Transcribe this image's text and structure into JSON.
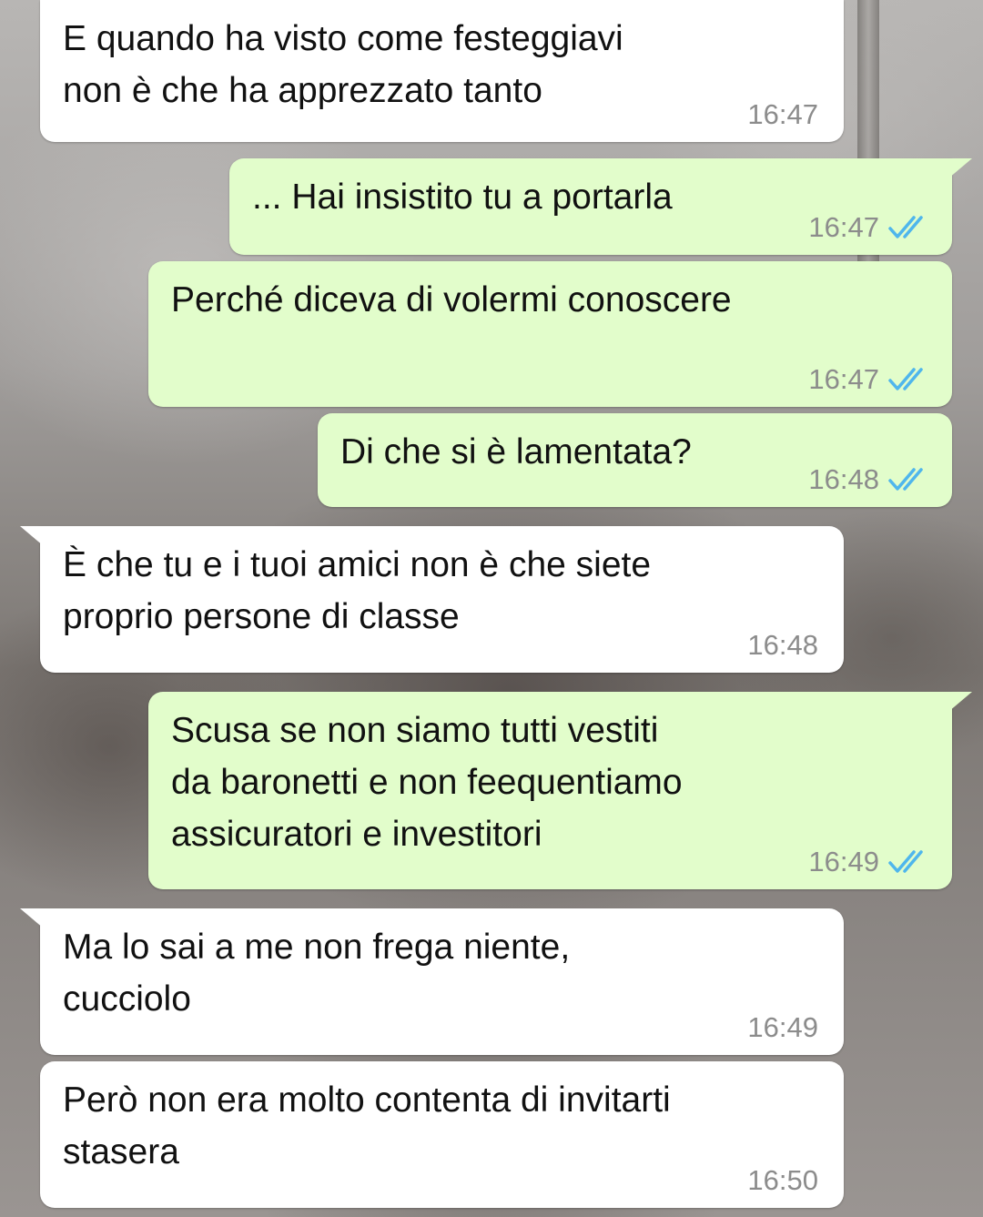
{
  "conversation": {
    "messages": [
      {
        "direction": "incoming",
        "text": "E quando ha visto come festeggiavi\nnon è che ha apprezzato tanto",
        "time": "16:47"
      },
      {
        "direction": "outgoing",
        "text": "... Hai insistito tu a portarla",
        "time": "16:47",
        "status": "read"
      },
      {
        "direction": "outgoing",
        "text": "Perché diceva di volermi conoscere",
        "time": "16:47",
        "status": "read"
      },
      {
        "direction": "outgoing",
        "text": "Di che si è lamentata?",
        "time": "16:48",
        "status": "read"
      },
      {
        "direction": "incoming",
        "text": "È che tu e i tuoi amici non è che siete\nproprio persone di classe",
        "time": "16:48"
      },
      {
        "direction": "outgoing",
        "text": "Scusa se non siamo tutti vestiti\nda baronetti e non feequentiamo\nassicuratori e investitori",
        "time": "16:49",
        "status": "read"
      },
      {
        "direction": "incoming",
        "text": "Ma lo sai a me non frega niente,\ncucciolo",
        "time": "16:49"
      },
      {
        "direction": "incoming",
        "text": "Però non era molto contenta di invitarti\nstasera",
        "time": "16:50"
      }
    ]
  },
  "colors": {
    "incoming_bubble": "#ffffff",
    "outgoing_bubble": "#e2fdcb",
    "read_ticks": "#4fb6ec",
    "timestamp": "#8c8c8c"
  },
  "icons": {
    "read_status": "double-check-icon"
  }
}
